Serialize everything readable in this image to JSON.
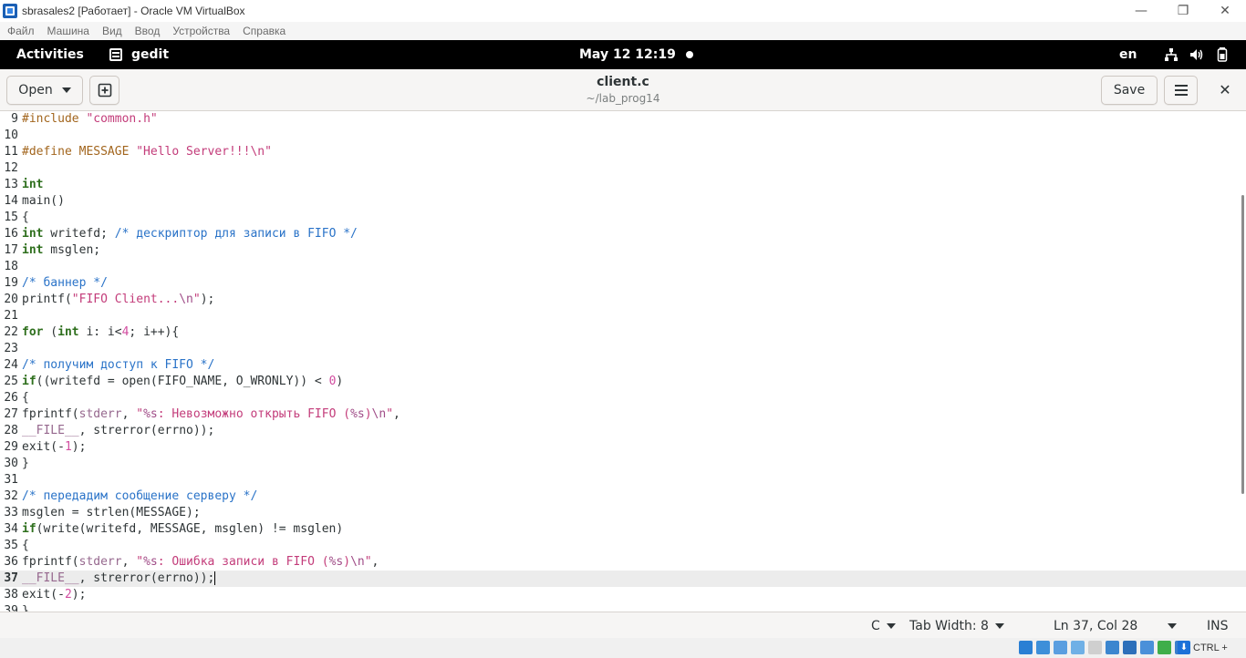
{
  "window": {
    "title": "sbrasales2 [Работает] - Oracle VM VirtualBox",
    "controls": {
      "minimize": "—",
      "maximize": "❐",
      "close": "✕"
    }
  },
  "vbox_menu": [
    "Файл",
    "Машина",
    "Вид",
    "Ввод",
    "Устройства",
    "Справка"
  ],
  "gnome": {
    "activities": "Activities",
    "app_name": "gedit",
    "clock": "May 12  12:19",
    "lang": "en"
  },
  "header": {
    "open_label": "Open",
    "save_label": "Save",
    "file_title": "client.c",
    "file_path": "~/lab_prog14",
    "close_glyph": "✕"
  },
  "editor": {
    "first_line_number": 9,
    "current_line": 37,
    "lines": [
      {
        "n": "9",
        "tokens": [
          [
            "pp",
            "#include "
          ],
          [
            "str",
            "\"common.h\""
          ]
        ]
      },
      {
        "n": "10",
        "tokens": []
      },
      {
        "n": "11",
        "tokens": [
          [
            "pp",
            "#define MESSAGE "
          ],
          [
            "str",
            "\"Hello Server!!!\\n\""
          ]
        ]
      },
      {
        "n": "12",
        "tokens": []
      },
      {
        "n": "13",
        "tokens": [
          [
            "kw",
            "int"
          ]
        ]
      },
      {
        "n": "14",
        "tokens": [
          [
            "",
            "main()"
          ]
        ]
      },
      {
        "n": "15",
        "tokens": [
          [
            "",
            "{"
          ]
        ]
      },
      {
        "n": "16",
        "tokens": [
          [
            "kw",
            "int"
          ],
          [
            "",
            " writefd; "
          ],
          [
            "cm",
            "/* дескриптор для записи в FIFO */"
          ]
        ]
      },
      {
        "n": "17",
        "tokens": [
          [
            "kw",
            "int"
          ],
          [
            "",
            " msglen;"
          ]
        ]
      },
      {
        "n": "18",
        "tokens": []
      },
      {
        "n": "19",
        "tokens": [
          [
            "cm",
            "/* баннер */"
          ]
        ]
      },
      {
        "n": "20",
        "tokens": [
          [
            "",
            "printf("
          ],
          [
            "str",
            "\"FIFO Client..."
          ],
          [
            "esc",
            "\\n"
          ],
          [
            "str",
            "\""
          ],
          [
            "",
            ");"
          ]
        ]
      },
      {
        "n": "21",
        "tokens": []
      },
      {
        "n": "22",
        "tokens": [
          [
            "kw",
            "for"
          ],
          [
            "",
            " ("
          ],
          [
            "kw",
            "int"
          ],
          [
            "",
            " i: i<"
          ],
          [
            "num",
            "4"
          ],
          [
            "",
            "; i++){"
          ]
        ]
      },
      {
        "n": "23",
        "tokens": []
      },
      {
        "n": "24",
        "tokens": [
          [
            "cm",
            "/* получим доступ к FIFO */"
          ]
        ]
      },
      {
        "n": "25",
        "tokens": [
          [
            "kw",
            "if"
          ],
          [
            "",
            "((writefd = open(FIFO_NAME, O_WRONLY)) < "
          ],
          [
            "num",
            "0"
          ],
          [
            "",
            ")"
          ]
        ]
      },
      {
        "n": "26",
        "tokens": [
          [
            "",
            "{"
          ]
        ]
      },
      {
        "n": "27",
        "tokens": [
          [
            "",
            "fprintf("
          ],
          [
            "sv",
            "stderr"
          ],
          [
            "",
            ", "
          ],
          [
            "str",
            "\""
          ],
          [
            "esc",
            "%s"
          ],
          [
            "str",
            ": Невозможно открыть FIFO ("
          ],
          [
            "esc",
            "%s"
          ],
          [
            "str",
            ")"
          ],
          [
            "esc",
            "\\n"
          ],
          [
            "str",
            "\""
          ],
          [
            "",
            ","
          ]
        ]
      },
      {
        "n": "28",
        "tokens": [
          [
            "sv",
            "__FILE__"
          ],
          [
            "",
            ", strerror(errno));"
          ]
        ]
      },
      {
        "n": "29",
        "tokens": [
          [
            "",
            "exit(-"
          ],
          [
            "num",
            "1"
          ],
          [
            "",
            ");"
          ]
        ]
      },
      {
        "n": "30",
        "tokens": [
          [
            "",
            "}"
          ]
        ]
      },
      {
        "n": "31",
        "tokens": []
      },
      {
        "n": "32",
        "tokens": [
          [
            "cm",
            "/* передадим сообщение серверу */"
          ]
        ]
      },
      {
        "n": "33",
        "tokens": [
          [
            "",
            "msglen = strlen(MESSAGE);"
          ]
        ]
      },
      {
        "n": "34",
        "tokens": [
          [
            "kw",
            "if"
          ],
          [
            "",
            "(write(writefd, MESSAGE, msglen) != msglen)"
          ]
        ]
      },
      {
        "n": "35",
        "tokens": [
          [
            "",
            "{"
          ]
        ]
      },
      {
        "n": "36",
        "tokens": [
          [
            "",
            "fprintf("
          ],
          [
            "sv",
            "stderr"
          ],
          [
            "",
            ", "
          ],
          [
            "str",
            "\""
          ],
          [
            "esc",
            "%s"
          ],
          [
            "str",
            ": Ошибка записи в FIFO ("
          ],
          [
            "esc",
            "%s"
          ],
          [
            "str",
            ")"
          ],
          [
            "esc",
            "\\n"
          ],
          [
            "str",
            "\""
          ],
          [
            "",
            ","
          ]
        ]
      },
      {
        "n": "37",
        "tokens": [
          [
            "sv",
            "__FILE__"
          ],
          [
            "",
            ", strerror(errno));"
          ]
        ]
      },
      {
        "n": "38",
        "tokens": [
          [
            "",
            "exit(-"
          ],
          [
            "num",
            "2"
          ],
          [
            "",
            ");"
          ]
        ]
      },
      {
        "n": "39",
        "tokens": [
          [
            "",
            "}"
          ]
        ]
      }
    ]
  },
  "status": {
    "language": "C",
    "tab_width": "Tab Width: 8",
    "position": "Ln 37, Col 28",
    "mode": "INS"
  },
  "vbox_status": {
    "host_key": "CTRL + ALT",
    "icon_colors": [
      "#2a7fd4",
      "#3d8fd9",
      "#5a9ee0",
      "#6fb0e6",
      "#cfcfcf",
      "#3b86cf",
      "#2d6fba",
      "#4a90d9",
      "#3fae4a",
      "#3a7fcc"
    ]
  }
}
